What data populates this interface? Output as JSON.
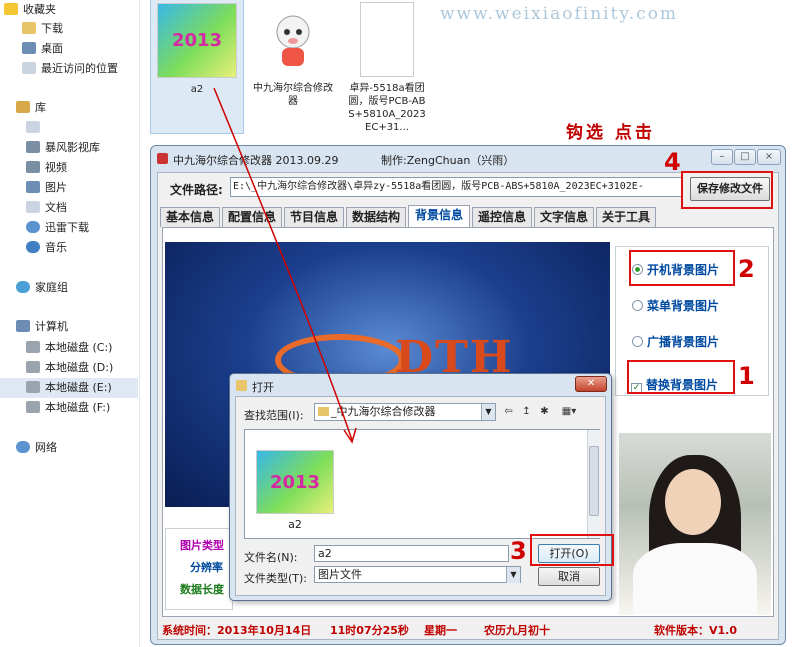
{
  "sidebar": {
    "favorites": "收藏夹",
    "favorites_items": [
      "下载",
      "桌面",
      "最近访问的位置"
    ],
    "library": "库",
    "library_items": [
      "暴风影视库",
      "视频",
      "图片",
      "文档",
      "迅雷下载",
      "音乐"
    ],
    "homegroup": "家庭组",
    "computer": "计算机",
    "drives": [
      "本地磁盘 (C:)",
      "本地磁盘 (D:)",
      "本地磁盘 (E:)",
      "本地磁盘 (F:)"
    ],
    "network": "网络"
  },
  "files": [
    {
      "name": "a2",
      "thumb_text": "2013"
    },
    {
      "name": "中九海尔综合修改器"
    },
    {
      "name": "卓异-5518a看团圆，版号PCB-ABS+5810A_2023EC+31..."
    }
  ],
  "watermark": "www.weixiaofinity.com",
  "hint": "钩选 点击",
  "app": {
    "title": "中九海尔综合修改器 2013.09.29",
    "author": "制作:ZengChuan（兴雨）",
    "path_label": "文件路径:",
    "path_value": "E:\\_中九海尔综合修改器\\卓异zy-5518a看团圆，版号PCB-ABS+5810A_2023EC+3102E-",
    "save_button": "保存修改文件",
    "tabs": [
      "基本信息",
      "配置信息",
      "节目信息",
      "数据结构",
      "背景信息",
      "遥控信息",
      "文字信息",
      "关于工具"
    ],
    "active_tab": "背景信息",
    "preview_logo": "DTH",
    "options": {
      "boot_bg": "开机背景图片",
      "menu_bg": "菜单背景图片",
      "broadcast_bg": "广播背景图片",
      "replace_bg": "替换背景图片"
    },
    "info_labels": [
      "图片类型",
      "分辨率",
      "数据长度"
    ],
    "status": {
      "system_time": "系统时间：2013年10月14日",
      "clock": "11时07分25秒",
      "weekday": "星期一",
      "lunar": "农历九月初十",
      "version": "软件版本：V1.0"
    }
  },
  "dialog": {
    "title": "打开",
    "lookin_label": "查找范围(I):",
    "lookin_value": "_中九海尔综合修改器",
    "file_name": "a2",
    "thumb_text": "2013",
    "filename_label": "文件名(N):",
    "filename_value": "a2",
    "filetype_label": "文件类型(T):",
    "filetype_value": "图片文件",
    "open_button": "打开(O)",
    "cancel_button": "取消"
  },
  "annotations": {
    "n1": "1",
    "n2": "2",
    "n3": "3",
    "n4": "4"
  },
  "colors": {
    "annotation_red": "#e01010",
    "option_blue": "#004aa0",
    "status_red": "#c00000"
  }
}
